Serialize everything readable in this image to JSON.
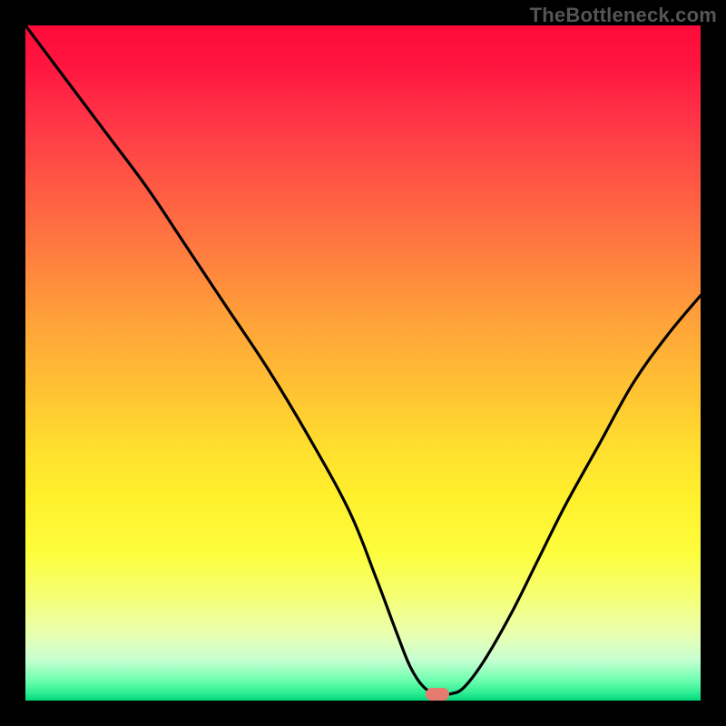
{
  "watermark": "TheBottleneck.com",
  "marker": {
    "color": "#e77a6f"
  },
  "colors": {
    "curve_stroke": "#000000",
    "frame_bg": "#000000"
  },
  "chart_data": {
    "type": "line",
    "title": "",
    "xlabel": "",
    "ylabel": "",
    "xlim": [
      0,
      100
    ],
    "ylim": [
      0,
      100
    ],
    "grid": false,
    "x": [
      0,
      6,
      12,
      18,
      24,
      30,
      36,
      42,
      48,
      52,
      55,
      57,
      59,
      61,
      63,
      65,
      68,
      72,
      76,
      80,
      85,
      90,
      95,
      100
    ],
    "values": [
      100,
      92,
      84,
      76,
      67,
      58,
      49,
      39,
      28,
      18,
      10,
      5,
      2,
      1,
      1,
      2,
      6,
      13,
      21,
      29,
      38,
      47,
      54,
      60
    ],
    "minimum": {
      "x": 61,
      "y": 1
    },
    "note": "Values approximate the visible black curve. y=0 is the bottom green band, y=100 is the top of the colored plot area."
  }
}
